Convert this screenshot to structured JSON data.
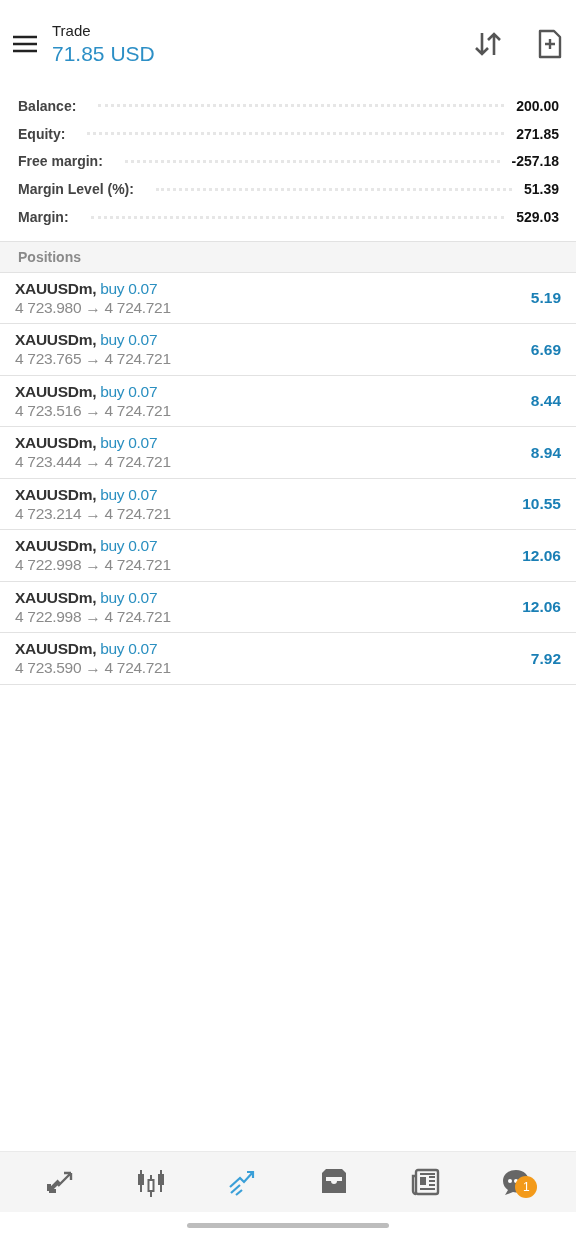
{
  "header": {
    "title": "Trade",
    "amount": "71.85 USD"
  },
  "summary": [
    {
      "label": "Balance:",
      "value": "200.00"
    },
    {
      "label": "Equity:",
      "value": "271.85"
    },
    {
      "label": "Free margin:",
      "value": "-257.18"
    },
    {
      "label": "Margin Level (%):",
      "value": "51.39"
    },
    {
      "label": "Margin:",
      "value": "529.03"
    }
  ],
  "positions": {
    "title": "Positions",
    "rows": [
      {
        "symbol": "XAUUSDm,",
        "order": "buy 0.07",
        "open": "4 723.980",
        "arrow": "→",
        "current": "4 724.721",
        "profit": "5.19"
      },
      {
        "symbol": "XAUUSDm,",
        "order": "buy 0.07",
        "open": "4 723.765",
        "arrow": "→",
        "current": "4 724.721",
        "profit": "6.69"
      },
      {
        "symbol": "XAUUSDm,",
        "order": "buy 0.07",
        "open": "4 723.516",
        "arrow": "→",
        "current": "4 724.721",
        "profit": "8.44"
      },
      {
        "symbol": "XAUUSDm,",
        "order": "buy 0.07",
        "open": "4 723.444",
        "arrow": "→",
        "current": "4 724.721",
        "profit": "8.94"
      },
      {
        "symbol": "XAUUSDm,",
        "order": "buy 0.07",
        "open": "4 723.214",
        "arrow": "→",
        "current": "4 724.721",
        "profit": "10.55"
      },
      {
        "symbol": "XAUUSDm,",
        "order": "buy 0.07",
        "open": "4 722.998",
        "arrow": "→",
        "current": "4 724.721",
        "profit": "12.06"
      },
      {
        "symbol": "XAUUSDm,",
        "order": "buy 0.07",
        "open": "4 722.998",
        "arrow": "→",
        "current": "4 724.721",
        "profit": "12.06"
      },
      {
        "symbol": "XAUUSDm,",
        "order": "buy 0.07",
        "open": "4 723.590",
        "arrow": "→",
        "current": "4 724.721",
        "profit": "7.92"
      }
    ]
  },
  "nav": [
    {
      "kind": "quotes",
      "selected": false
    },
    {
      "kind": "chart",
      "selected": false
    },
    {
      "kind": "trade",
      "selected": true
    },
    {
      "kind": "history",
      "selected": false
    },
    {
      "kind": "news",
      "selected": false
    },
    {
      "kind": "chat",
      "selected": false,
      "badge": "1"
    }
  ]
}
